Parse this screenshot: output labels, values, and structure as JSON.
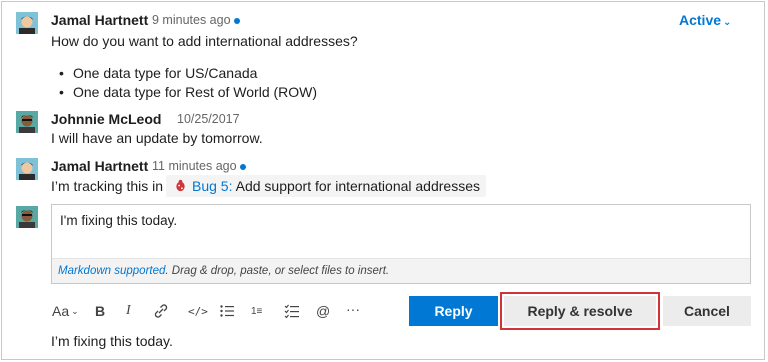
{
  "thread": {
    "status": "Active",
    "comments": [
      {
        "author": "Jamal Hartnett",
        "time": "9 minutes ago",
        "text": "How do you want to add international addresses?",
        "bullets": [
          "One data type for US/Canada",
          "One data type for Rest of World (ROW)"
        ]
      },
      {
        "author": "Johnnie McLeod",
        "time": "10/25/2017",
        "text": "I will have an update by tomorrow."
      },
      {
        "author": "Jamal Hartnett",
        "time": "11 minutes ago",
        "text_prefix": "I’m tracking this in",
        "work_item": {
          "link": "Bug 5:",
          "title": "Add support for international addresses"
        }
      }
    ]
  },
  "editor": {
    "value": "I'm fixing this today.",
    "footer_link": "Markdown supported",
    "footer_text": ". Drag & drop, paste, or select files to insert."
  },
  "toolbar": {
    "format_label": "Aa",
    "bold": "B",
    "italic": "I",
    "ordered_list": "1≡",
    "mention": "@",
    "more": "···"
  },
  "buttons": {
    "reply": "Reply",
    "reply_resolve": "Reply & resolve",
    "cancel": "Cancel"
  },
  "preview": "I’m fixing this today.",
  "colors": {
    "accent": "#0078d4",
    "highlight": "#d13438"
  }
}
